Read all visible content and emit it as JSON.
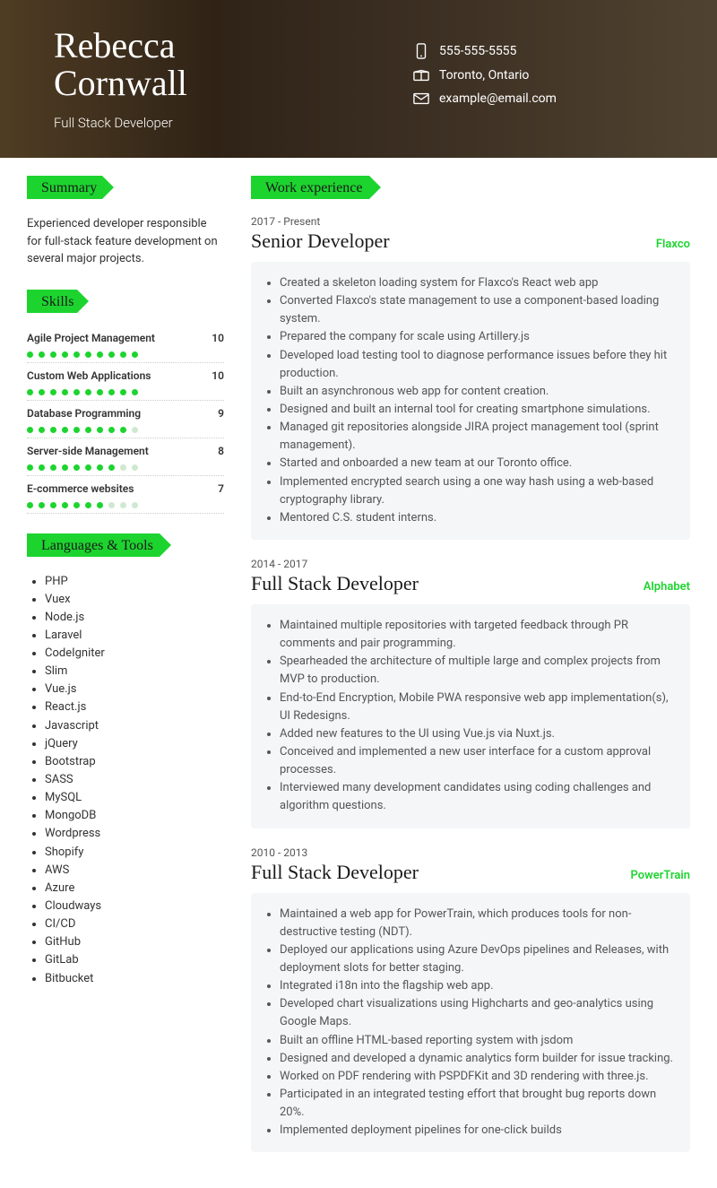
{
  "header": {
    "firstName": "Rebecca",
    "lastName": "Cornwall",
    "tagline": "Full Stack Developer",
    "phone": "555-555-5555",
    "location": "Toronto, Ontario",
    "email": "example@email.com"
  },
  "sections": {
    "summary": "Summary",
    "skills": "Skills",
    "langs": "Languages & Tools",
    "work": "Work experience"
  },
  "summaryText": "Experienced developer responsible for full-stack feature development on several major projects.",
  "skills": [
    {
      "name": "Agile Project Management",
      "score": 10
    },
    {
      "name": "Custom Web Applications",
      "score": 10
    },
    {
      "name": "Database Programming",
      "score": 9
    },
    {
      "name": "Server-side Management",
      "score": 8
    },
    {
      "name": "E-commerce websites",
      "score": 7
    }
  ],
  "langs": [
    "PHP",
    "Vuex",
    "Node.js",
    "Laravel",
    "CodeIgniter",
    "Slim",
    "Vue.js",
    "React.js",
    "Javascript",
    "jQuery",
    "Bootstrap",
    "SASS",
    "MySQL",
    "MongoDB",
    "Wordpress",
    "Shopify",
    "AWS",
    "Azure",
    "Cloudways",
    "CI/CD",
    "GitHub",
    "GitLab",
    "Bitbucket"
  ],
  "jobs": [
    {
      "dates": "2017 - Present",
      "title": "Senior Developer",
      "company": "Flaxco",
      "bullets": [
        "Created a skeleton loading system for Flaxco's React web app",
        "Converted Flaxco's state management to use a component-based loading system.",
        "Prepared the company for scale using Artillery.js",
        "Developed load testing tool to diagnose performance issues before they hit production.",
        "Built an asynchronous web app for content creation.",
        "Designed and built an internal tool for creating smartphone simulations.",
        "Managed git repositories alongside JIRA project management tool (sprint management).",
        "Started and onboarded a new team at our Toronto office.",
        "Implemented encrypted search using a one way hash using a web-based cryptography library.",
        "Mentored C.S. student interns."
      ]
    },
    {
      "dates": "2014 - 2017",
      "title": "Full Stack Developer",
      "company": "Alphabet",
      "bullets": [
        "Maintained multiple repositories with targeted feedback through PR comments and pair programming.",
        "Spearheaded the architecture of multiple large and complex projects from MVP to production.",
        "End-to-End Encryption, Mobile PWA responsive web app implementation(s), UI Redesigns.",
        "Added new features to the UI using Vue.js via Nuxt.js.",
        "Conceived and implemented a new user interface for a custom approval processes.",
        "Interviewed many development candidates using coding challenges and algorithm questions."
      ]
    },
    {
      "dates": "2010 - 2013",
      "title": "Full Stack Developer",
      "company": "PowerTrain",
      "bullets": [
        "Maintained a web app for PowerTrain, which produces tools for non-destructive testing (NDT).",
        "Deployed our applications using Azure DevOps pipelines and Releases, with deployment slots for better staging.",
        "Integrated i18n into the flagship web app.",
        " Developed  chart visualizations using Highcharts and geo-analytics using Google Maps.",
        "Built an offline HTML-based reporting system with jsdom",
        "Designed and developed a dynamic analytics form builder for issue tracking.",
        "Worked on PDF rendering with PSPDFKit and 3D rendering with three.js.",
        "Participated in an integrated testing effort that brought bug reports down 20%.",
        "Implemented deployment pipelines for one-click builds"
      ]
    }
  ]
}
